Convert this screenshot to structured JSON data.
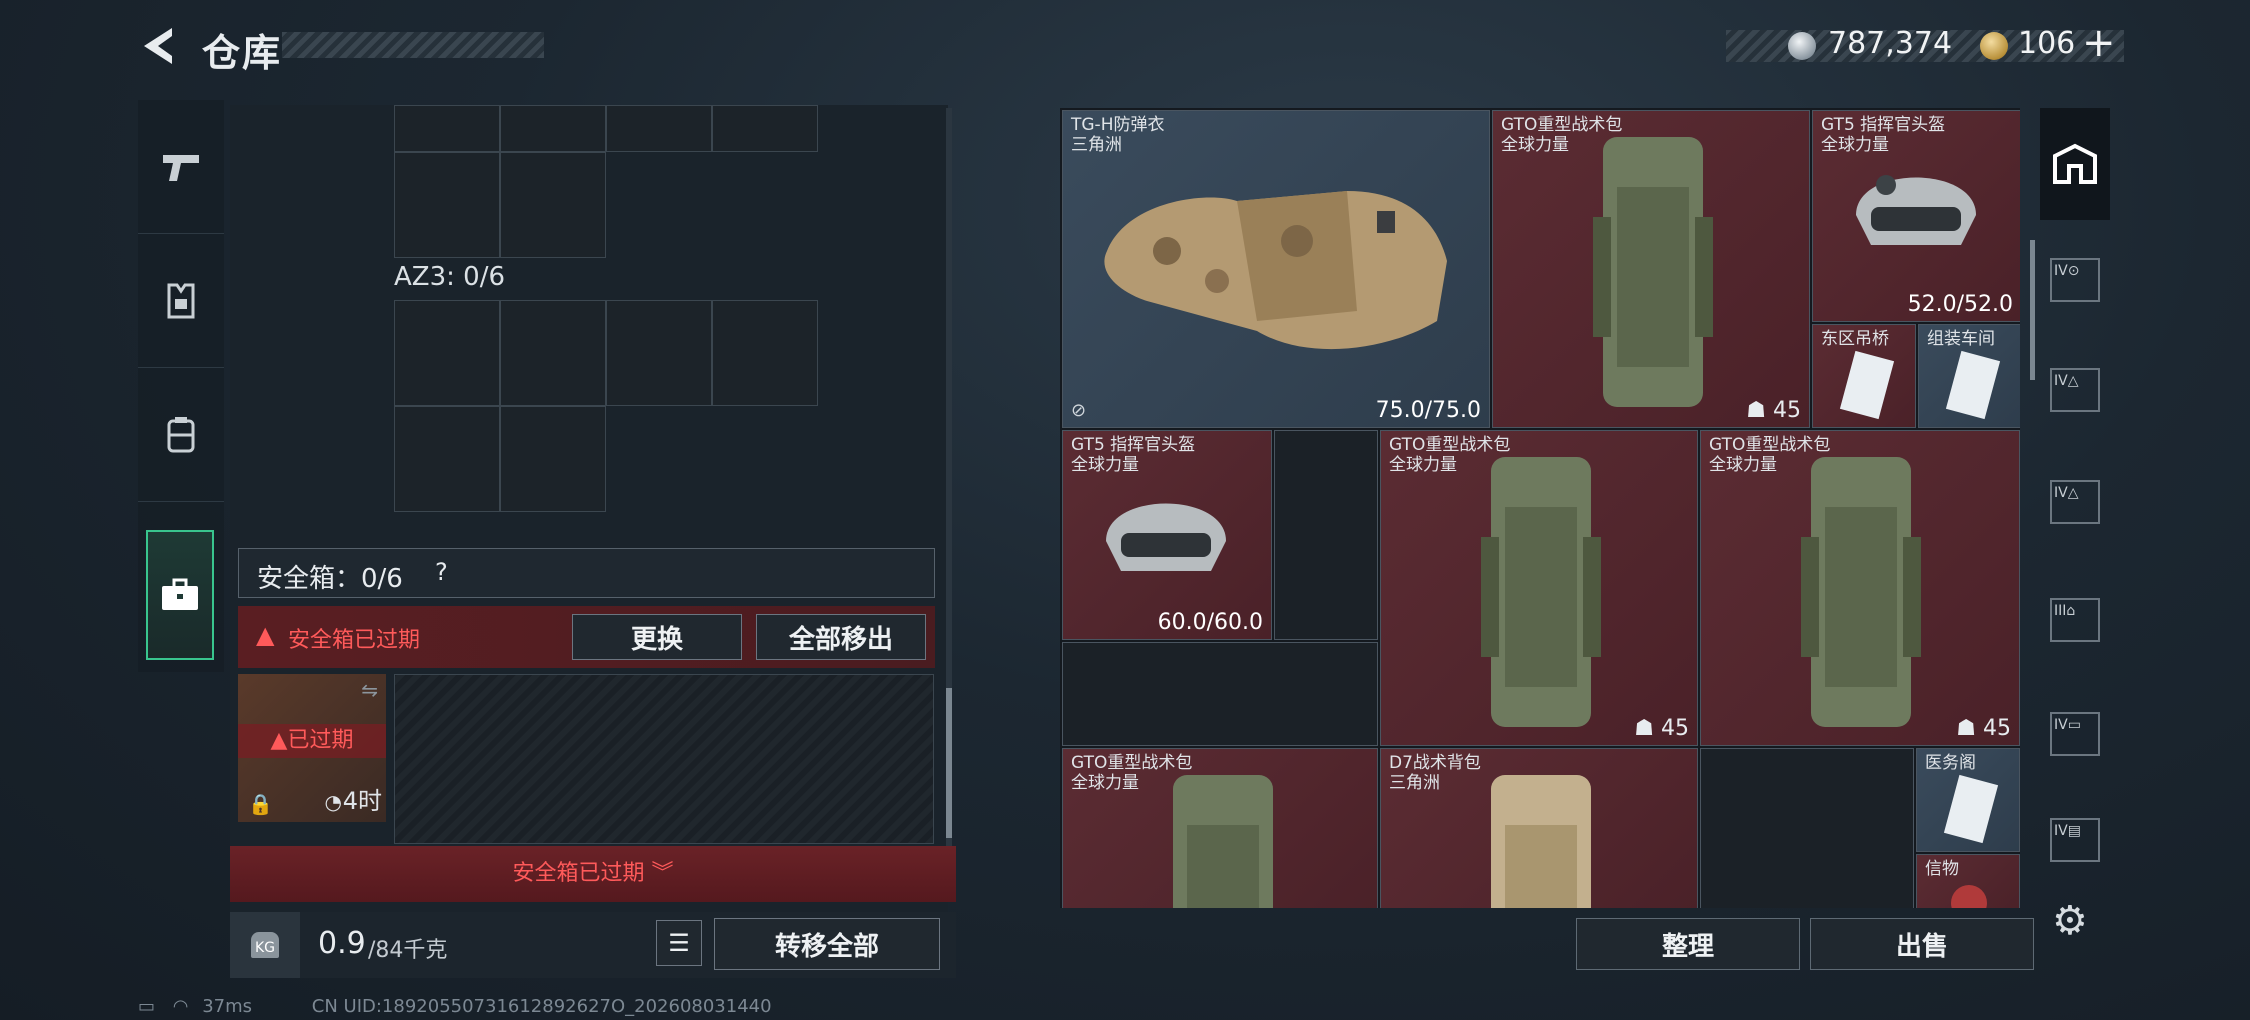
{
  "header": {
    "title": "仓库",
    "silver": "787,374",
    "gold": "106",
    "plus": "+"
  },
  "left": {
    "az3_label": "AZ3: 0/6",
    "safe_box": "安全箱：0/6",
    "help": "?",
    "warning": "安全箱已过期",
    "replace": "更换",
    "move_all": "全部移出",
    "expired_tag": "已过期",
    "timer": "4时",
    "expired_strip": "安全箱已过期",
    "weight": "0.9",
    "weight_unit": "/84千克",
    "transfer_all": "转移全部",
    "kg": "KG"
  },
  "items": [
    {
      "name": "TG-H防弹衣",
      "sub": "三角洲",
      "dur": "75.0/75.0"
    },
    {
      "name": "GTO重型战术包",
      "sub": "全球力量",
      "count": "45"
    },
    {
      "name": "GT5 指挥官头盔",
      "sub": "全球力量",
      "dur": "52.0/52.0"
    },
    {
      "name": "东区吊桥"
    },
    {
      "name": "组装车间"
    },
    {
      "name": "GT5 指挥官头盔",
      "sub": "全球力量",
      "dur": "60.0/60.0"
    },
    {
      "name": "GTO重型战术包",
      "sub": "全球力量",
      "count": "45"
    },
    {
      "name": "GTO重型战术包",
      "sub": "全球力量",
      "count": "45"
    },
    {
      "name": "GTO重型战术包",
      "sub": "全球力量"
    },
    {
      "name": "D7战术背包",
      "sub": "三角洲"
    },
    {
      "name": "医务阁"
    },
    {
      "name": "信物"
    }
  ],
  "right": {
    "sort": "整理",
    "sell": "出售"
  },
  "footer": {
    "ping": "37ms",
    "uid": "CN UID:18920550731612892627O_202608031440"
  }
}
